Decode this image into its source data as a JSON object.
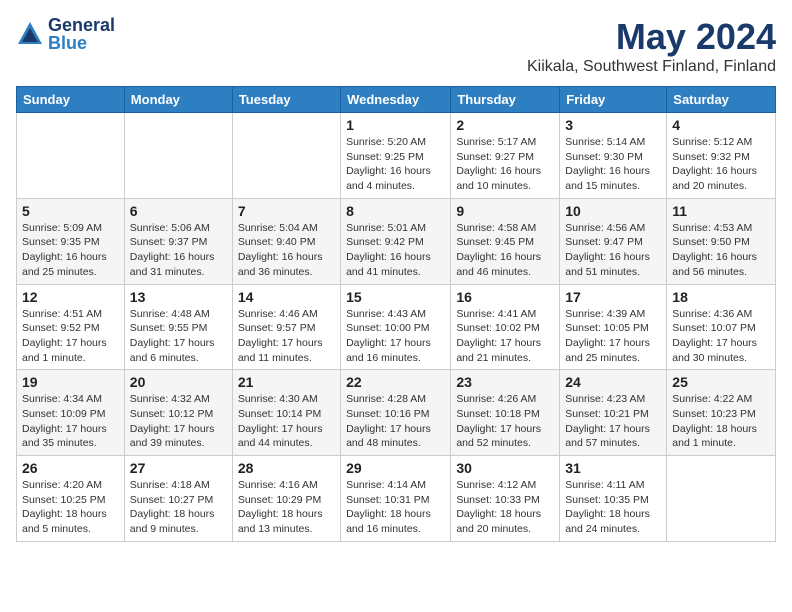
{
  "logo": {
    "general": "General",
    "blue": "Blue"
  },
  "title": "May 2024",
  "subtitle": "Kiikala, Southwest Finland, Finland",
  "headers": [
    "Sunday",
    "Monday",
    "Tuesday",
    "Wednesday",
    "Thursday",
    "Friday",
    "Saturday"
  ],
  "weeks": [
    [
      {
        "day": "",
        "info": ""
      },
      {
        "day": "",
        "info": ""
      },
      {
        "day": "",
        "info": ""
      },
      {
        "day": "1",
        "info": "Sunrise: 5:20 AM\nSunset: 9:25 PM\nDaylight: 16 hours\nand 4 minutes."
      },
      {
        "day": "2",
        "info": "Sunrise: 5:17 AM\nSunset: 9:27 PM\nDaylight: 16 hours\nand 10 minutes."
      },
      {
        "day": "3",
        "info": "Sunrise: 5:14 AM\nSunset: 9:30 PM\nDaylight: 16 hours\nand 15 minutes."
      },
      {
        "day": "4",
        "info": "Sunrise: 5:12 AM\nSunset: 9:32 PM\nDaylight: 16 hours\nand 20 minutes."
      }
    ],
    [
      {
        "day": "5",
        "info": "Sunrise: 5:09 AM\nSunset: 9:35 PM\nDaylight: 16 hours\nand 25 minutes."
      },
      {
        "day": "6",
        "info": "Sunrise: 5:06 AM\nSunset: 9:37 PM\nDaylight: 16 hours\nand 31 minutes."
      },
      {
        "day": "7",
        "info": "Sunrise: 5:04 AM\nSunset: 9:40 PM\nDaylight: 16 hours\nand 36 minutes."
      },
      {
        "day": "8",
        "info": "Sunrise: 5:01 AM\nSunset: 9:42 PM\nDaylight: 16 hours\nand 41 minutes."
      },
      {
        "day": "9",
        "info": "Sunrise: 4:58 AM\nSunset: 9:45 PM\nDaylight: 16 hours\nand 46 minutes."
      },
      {
        "day": "10",
        "info": "Sunrise: 4:56 AM\nSunset: 9:47 PM\nDaylight: 16 hours\nand 51 minutes."
      },
      {
        "day": "11",
        "info": "Sunrise: 4:53 AM\nSunset: 9:50 PM\nDaylight: 16 hours\nand 56 minutes."
      }
    ],
    [
      {
        "day": "12",
        "info": "Sunrise: 4:51 AM\nSunset: 9:52 PM\nDaylight: 17 hours\nand 1 minute."
      },
      {
        "day": "13",
        "info": "Sunrise: 4:48 AM\nSunset: 9:55 PM\nDaylight: 17 hours\nand 6 minutes."
      },
      {
        "day": "14",
        "info": "Sunrise: 4:46 AM\nSunset: 9:57 PM\nDaylight: 17 hours\nand 11 minutes."
      },
      {
        "day": "15",
        "info": "Sunrise: 4:43 AM\nSunset: 10:00 PM\nDaylight: 17 hours\nand 16 minutes."
      },
      {
        "day": "16",
        "info": "Sunrise: 4:41 AM\nSunset: 10:02 PM\nDaylight: 17 hours\nand 21 minutes."
      },
      {
        "day": "17",
        "info": "Sunrise: 4:39 AM\nSunset: 10:05 PM\nDaylight: 17 hours\nand 25 minutes."
      },
      {
        "day": "18",
        "info": "Sunrise: 4:36 AM\nSunset: 10:07 PM\nDaylight: 17 hours\nand 30 minutes."
      }
    ],
    [
      {
        "day": "19",
        "info": "Sunrise: 4:34 AM\nSunset: 10:09 PM\nDaylight: 17 hours\nand 35 minutes."
      },
      {
        "day": "20",
        "info": "Sunrise: 4:32 AM\nSunset: 10:12 PM\nDaylight: 17 hours\nand 39 minutes."
      },
      {
        "day": "21",
        "info": "Sunrise: 4:30 AM\nSunset: 10:14 PM\nDaylight: 17 hours\nand 44 minutes."
      },
      {
        "day": "22",
        "info": "Sunrise: 4:28 AM\nSunset: 10:16 PM\nDaylight: 17 hours\nand 48 minutes."
      },
      {
        "day": "23",
        "info": "Sunrise: 4:26 AM\nSunset: 10:18 PM\nDaylight: 17 hours\nand 52 minutes."
      },
      {
        "day": "24",
        "info": "Sunrise: 4:23 AM\nSunset: 10:21 PM\nDaylight: 17 hours\nand 57 minutes."
      },
      {
        "day": "25",
        "info": "Sunrise: 4:22 AM\nSunset: 10:23 PM\nDaylight: 18 hours\nand 1 minute."
      }
    ],
    [
      {
        "day": "26",
        "info": "Sunrise: 4:20 AM\nSunset: 10:25 PM\nDaylight: 18 hours\nand 5 minutes."
      },
      {
        "day": "27",
        "info": "Sunrise: 4:18 AM\nSunset: 10:27 PM\nDaylight: 18 hours\nand 9 minutes."
      },
      {
        "day": "28",
        "info": "Sunrise: 4:16 AM\nSunset: 10:29 PM\nDaylight: 18 hours\nand 13 minutes."
      },
      {
        "day": "29",
        "info": "Sunrise: 4:14 AM\nSunset: 10:31 PM\nDaylight: 18 hours\nand 16 minutes."
      },
      {
        "day": "30",
        "info": "Sunrise: 4:12 AM\nSunset: 10:33 PM\nDaylight: 18 hours\nand 20 minutes."
      },
      {
        "day": "31",
        "info": "Sunrise: 4:11 AM\nSunset: 10:35 PM\nDaylight: 18 hours\nand 24 minutes."
      },
      {
        "day": "",
        "info": ""
      }
    ]
  ]
}
